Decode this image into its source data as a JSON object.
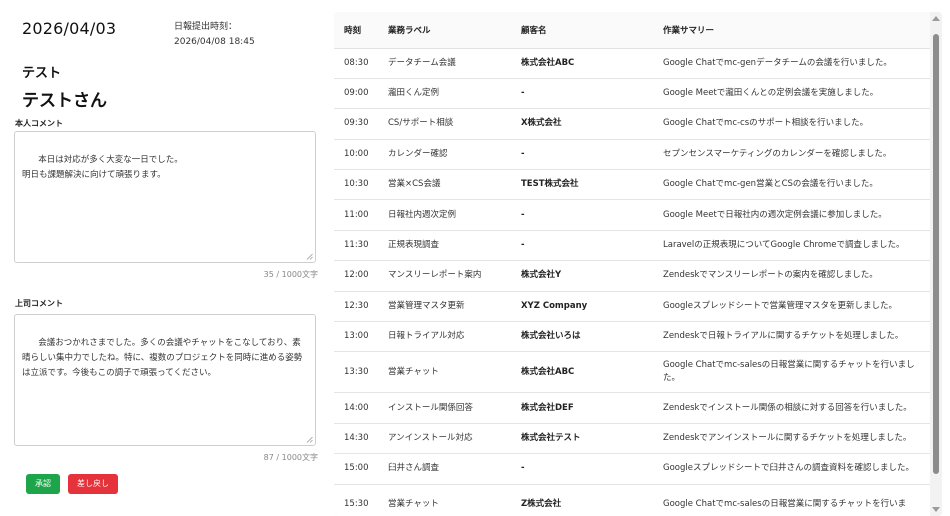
{
  "report": {
    "date": "2026/04/03",
    "submitted_label": "日報提出時刻：",
    "submitted_time": "2026/04/08 18:45",
    "department": "テスト",
    "user_name": "テストさん"
  },
  "self_comment": {
    "label": "本人コメント",
    "text": "本日は対応が多く大変な一日でした。\n明日も課題解決に向けて頑張ります。",
    "count": "35 / 1000文字"
  },
  "boss_comment": {
    "label": "上司コメント",
    "text": "会議おつかれさまでした。多くの会議やチャットをこなしており、素晴らしい集中力でしたね。特に、複数のプロジェクトを同時に進める姿勢は立派です。今後もこの調子で頑張ってください。",
    "count": "87 / 1000文字"
  },
  "actions": {
    "approve": "承認",
    "return": "差し戻し"
  },
  "colors": {
    "approve": "#1ea44a",
    "return": "#e5323b"
  },
  "table": {
    "headers": [
      "時刻",
      "業務ラベル",
      "顧客名",
      "作業サマリー"
    ],
    "rows": [
      {
        "time": "08:30",
        "label": "データチーム会議",
        "customer": "株式会社ABC",
        "summary": "Google Chatでmc-genデータチームの会議を行いました。"
      },
      {
        "time": "09:00",
        "label": "瀧田くん定例",
        "customer": "-",
        "summary": "Google Meetで瀧田くんとの定例会議を実施しました。"
      },
      {
        "time": "09:30",
        "label": "CS/サポート相談",
        "customer": "X株式会社",
        "summary": "Google Chatでmc-csのサポート相談を行いました。"
      },
      {
        "time": "10:00",
        "label": "カレンダー確認",
        "customer": "-",
        "summary": "セプンセンスマーケティングのカレンダーを確認しました。"
      },
      {
        "time": "10:30",
        "label": "営業×CS会議",
        "customer": "TEST株式会社",
        "summary": "Google Chatでmc-gen営業とCSの会議を行いました。"
      },
      {
        "time": "11:00",
        "label": "日報社内週次定例",
        "customer": "-",
        "summary": "Google Meetで日報社内の週次定例会議に参加しました。"
      },
      {
        "time": "11:30",
        "label": "正規表現調査",
        "customer": "-",
        "summary": "Laravelの正規表現についてGoogle Chromeで調査しました。"
      },
      {
        "time": "12:00",
        "label": "マンスリーレポート案内",
        "customer": "株式会社Y",
        "summary": "Zendeskでマンスリーレポートの案内を確認しました。"
      },
      {
        "time": "12:30",
        "label": "営業管理マスタ更新",
        "customer": "XYZ Company",
        "summary": "Googleスプレッドシートで営業管理マスタを更新しました。"
      },
      {
        "time": "13:00",
        "label": "日報トライアル対応",
        "customer": "株式会社いろは",
        "summary": "Zendeskで日報トライアルに関するチケットを処理しました。"
      },
      {
        "time": "13:30",
        "label": "営業チャット",
        "customer": "株式会社ABC",
        "summary": "Google Chatでmc-salesの日報営業に関するチャットを行いました。"
      },
      {
        "time": "14:00",
        "label": "インストール関係回答",
        "customer": "株式会社DEF",
        "summary": "Zendeskでインストール関係の相談に対する回答を行いました。"
      },
      {
        "time": "14:30",
        "label": "アンインストール対応",
        "customer": "株式会社テスト",
        "summary": "Zendeskでアンインストールに関するチケットを処理しました。"
      },
      {
        "time": "15:00",
        "label": "臼井さん調査",
        "customer": "-",
        "summary": "Googleスプレッドシートで臼井さんの調査資料を確認しました。"
      },
      {
        "time": "15:30",
        "label": "営業チャット",
        "customer": "Z株式会社",
        "summary": "Google Chatでmc-salesの日報営業に関するチャットを行いま"
      }
    ]
  }
}
